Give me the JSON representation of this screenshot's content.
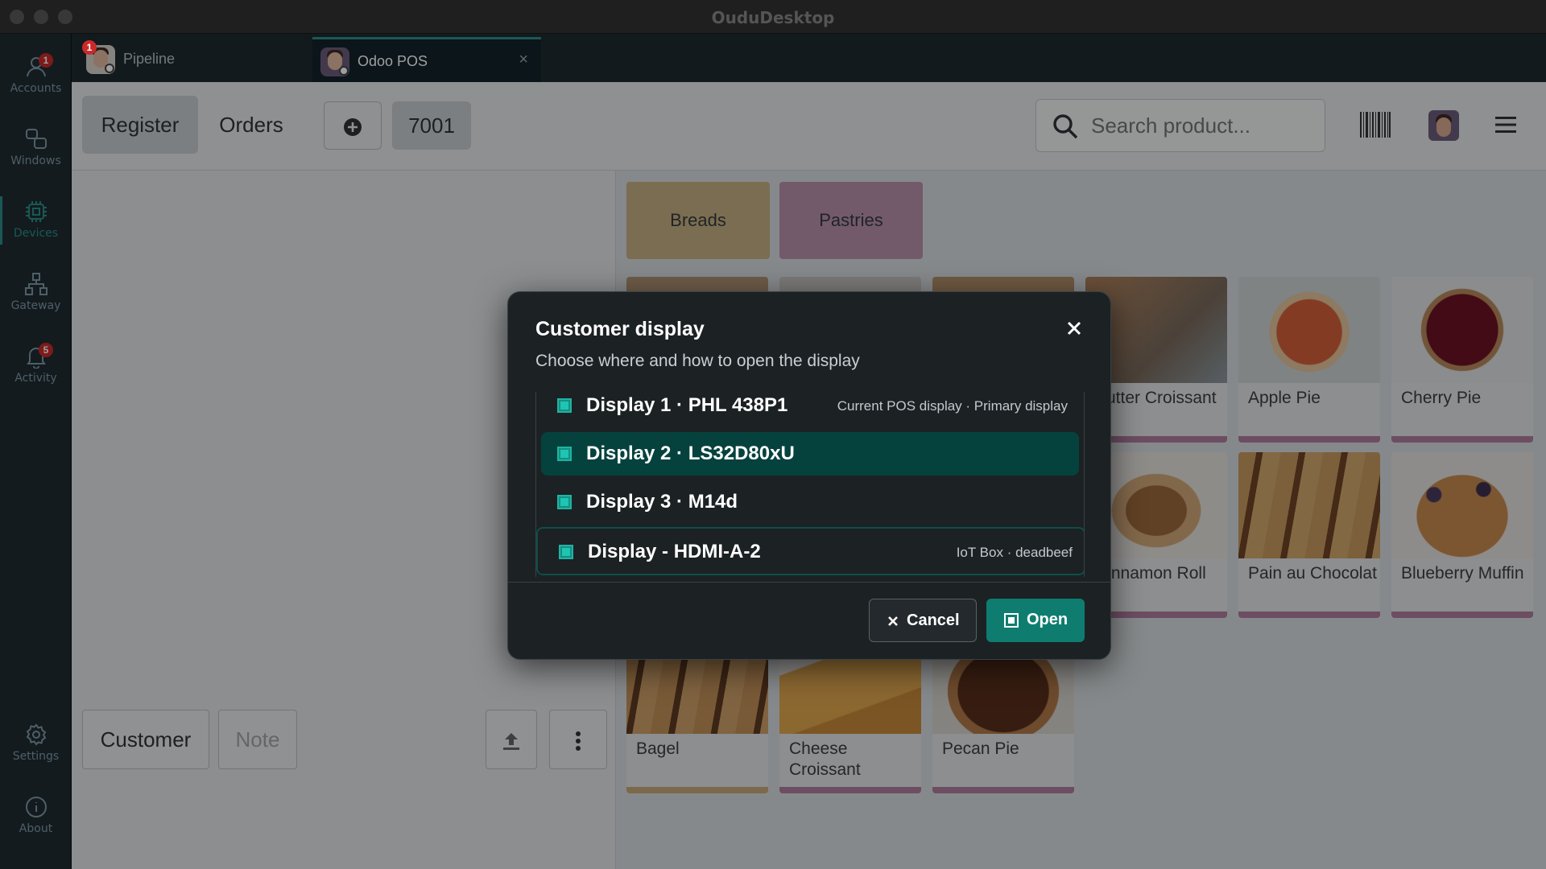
{
  "window": {
    "title": "OuduDesktop"
  },
  "rail": {
    "items": [
      {
        "id": "accounts",
        "label": "Accounts",
        "icon": "user-icon",
        "badge": "1"
      },
      {
        "id": "windows",
        "label": "Windows",
        "icon": "windows-icon",
        "badge": ""
      },
      {
        "id": "devices",
        "label": "Devices",
        "icon": "chip-icon",
        "badge": "",
        "active": true
      },
      {
        "id": "gateway",
        "label": "Gateway",
        "icon": "network-icon",
        "badge": ""
      },
      {
        "id": "activity",
        "label": "Activity",
        "icon": "bell-icon",
        "badge": "5"
      },
      {
        "id": "settings",
        "label": "Settings",
        "icon": "gear-icon",
        "badge": ""
      },
      {
        "id": "about",
        "label": "About",
        "icon": "info-icon",
        "badge": ""
      }
    ]
  },
  "tabs": [
    {
      "label": "Pipeline",
      "badge": "1"
    },
    {
      "label": "Odoo POS",
      "close": "×"
    }
  ],
  "pos": {
    "register_label": "Register",
    "orders_label": "Orders",
    "order_number": "7001",
    "search_placeholder": "Search product...",
    "customer_label": "Customer",
    "note_label": "Note",
    "categories": [
      {
        "label": "Breads",
        "color": "#c7b184"
      },
      {
        "label": "Pastries",
        "color": "#b992ad"
      }
    ],
    "products": [
      {
        "name": "Butter Croissant",
        "border": "#b07c9f"
      },
      {
        "name": "Apple Pie",
        "border": "#b07c9f"
      },
      {
        "name": "Cherry Pie",
        "border": "#b07c9f"
      },
      {
        "name": "Cinnamon Roll",
        "border": "#b07c9f"
      },
      {
        "name": "Pain au Chocolat",
        "border": "#b07c9f"
      },
      {
        "name": "Blueberry Muffin",
        "border": "#b07c9f"
      },
      {
        "name": "Bagel",
        "border": "#c9a878"
      },
      {
        "name": "Cheese Croissant",
        "border": "#b07c9f"
      },
      {
        "name": "Pecan Pie",
        "border": "#b07c9f"
      }
    ]
  },
  "modal": {
    "title": "Customer display",
    "subtitle": "Choose where and how to open the display",
    "displays": [
      {
        "name": "Display 1 · PHL 438P1",
        "meta": "Current POS display · Primary display"
      },
      {
        "name": "Display 2 · LS32D80xU",
        "meta": "",
        "selected": true
      },
      {
        "name": "Display 3 · M14d",
        "meta": ""
      },
      {
        "name": "Display - HDMI-A-2",
        "meta": "IoT Box · deadbeef"
      }
    ],
    "cancel_label": "Cancel",
    "open_label": "Open"
  },
  "colors": {
    "accent": "#2c8e8a",
    "selected_row": "#06423d",
    "open_button": "#0e7d70",
    "badge": "#cc2a2a"
  }
}
